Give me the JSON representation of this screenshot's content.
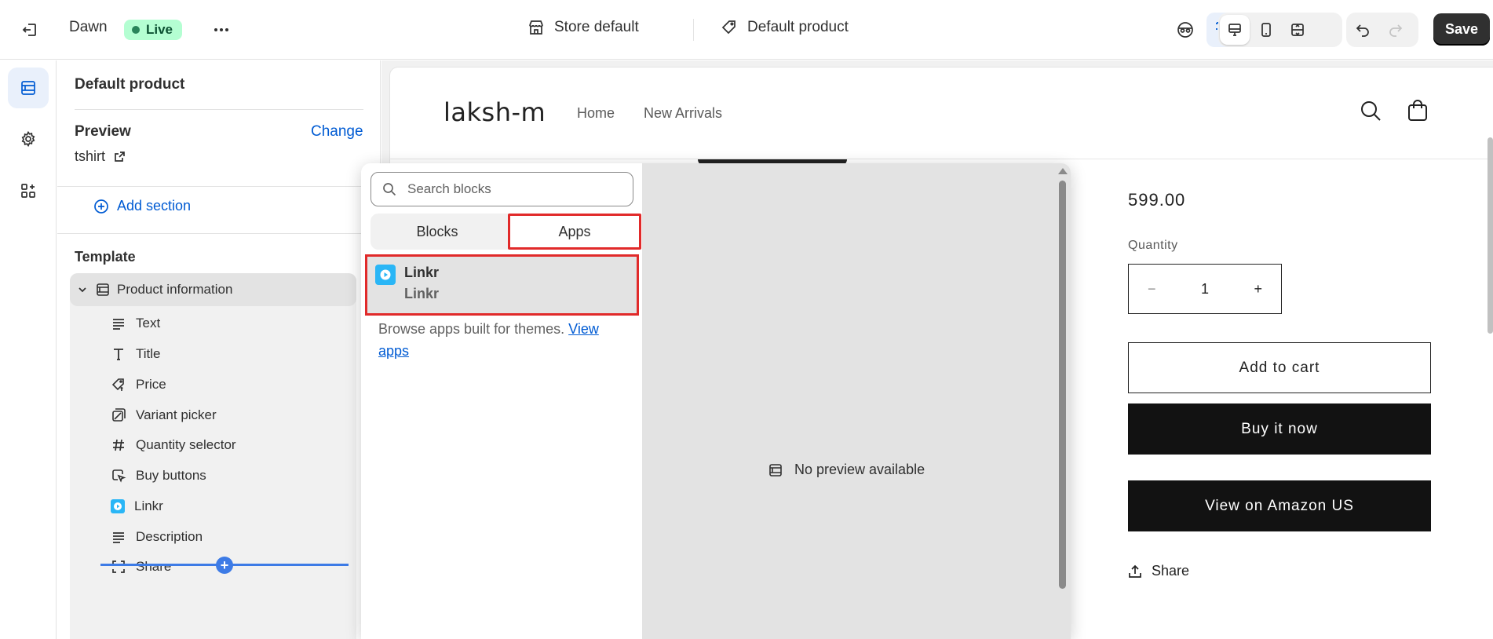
{
  "topbar": {
    "theme_name": "Dawn",
    "status_badge": "Live",
    "store_label": "Store default",
    "template_label": "Default product",
    "save_label": "Save"
  },
  "sidebar": {
    "title": "Default product",
    "preview_label": "Preview",
    "change_label": "Change",
    "preview_value": "tshirt",
    "add_section_label": "Add section",
    "template_label": "Template",
    "section_name": "Product information",
    "blocks": [
      {
        "label": "Text",
        "icon": "text-icon"
      },
      {
        "label": "Title",
        "icon": "title-icon"
      },
      {
        "label": "Price",
        "icon": "price-tag-icon"
      },
      {
        "label": "Variant picker",
        "icon": "variant-icon"
      },
      {
        "label": "Quantity selector",
        "icon": "hash-icon"
      },
      {
        "label": "Buy buttons",
        "icon": "cursor-icon"
      },
      {
        "label": "Linkr",
        "icon": "linkr-app-icon"
      },
      {
        "label": "Description",
        "icon": "text-icon"
      },
      {
        "label": "Share",
        "icon": "share-frame-icon"
      }
    ]
  },
  "picker": {
    "search_placeholder": "Search blocks",
    "tabs": [
      "Blocks",
      "Apps"
    ],
    "active_tab": "Apps",
    "app": {
      "name": "Linkr",
      "subtitle": "Linkr"
    },
    "browse_text": "Browse apps built for themes.",
    "browse_link": "View apps",
    "no_preview": "No preview available"
  },
  "store": {
    "logo": "laksh-m",
    "nav": [
      "Home",
      "New Arrivals"
    ],
    "price": "599.00",
    "quantity_label": "Quantity",
    "quantity_value": "1",
    "qty_minus": "−",
    "qty_plus": "+",
    "add_to_cart": "Add to cart",
    "buy_now": "Buy it now",
    "amazon": "View on Amazon US",
    "share": "Share"
  },
  "colors": {
    "accent": "#005bd3",
    "live_bg": "#b4fed2",
    "highlight_border": "#e12a2a",
    "drop_line": "#3d7be6",
    "app_icon": "#2ab6f6"
  }
}
